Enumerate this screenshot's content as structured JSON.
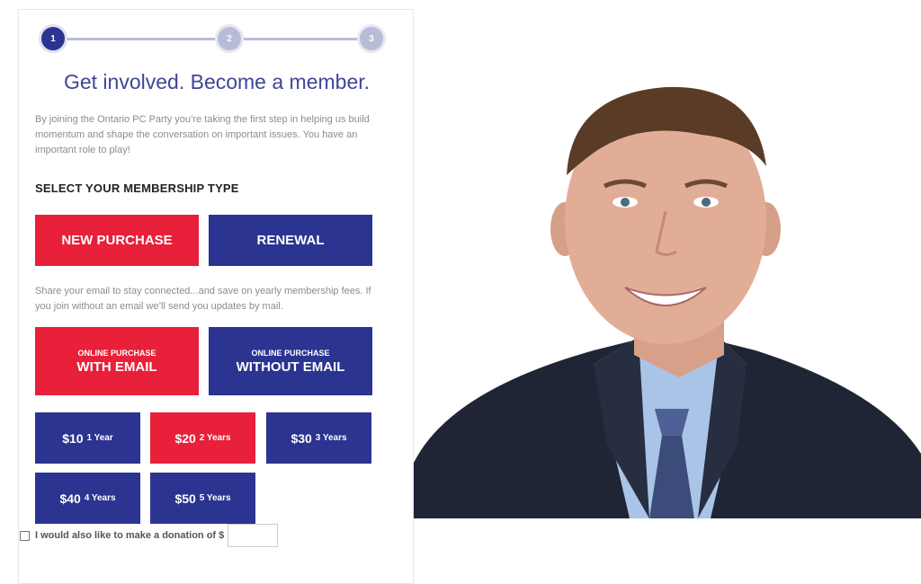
{
  "stepper": {
    "steps": [
      "1",
      "2",
      "3"
    ]
  },
  "title": "Get involved. Become a member.",
  "intro": "By joining the Ontario PC Party you’re taking the first step in helping us build momentum and shape the conversation on important issues. You have an important role to play!",
  "membership": {
    "heading": "SELECT YOUR MEMBERSHIP TYPE",
    "new_purchase": "NEW PURCHASE",
    "renewal": "RENEWAL"
  },
  "email_note": "Share your email to stay connected...and save on yearly membership fees. If you join without an email we’ll send you updates by mail.",
  "purchase": {
    "with_email_top": "ONLINE PURCHASE",
    "with_email_main": "WITH EMAIL",
    "without_email_top": "ONLINE PURCHASE",
    "without_email_main": "WITHOUT EMAIL"
  },
  "options": [
    {
      "price": "$10",
      "term": "1 Year"
    },
    {
      "price": "$20",
      "term": "2 Years"
    },
    {
      "price": "$30",
      "term": "3 Years"
    },
    {
      "price": "$40",
      "term": "4 Years"
    },
    {
      "price": "$50",
      "term": "5 Years"
    }
  ],
  "donation": {
    "label": "I would also like to make a donation of $",
    "value": ""
  },
  "colors": {
    "red": "#e8203a",
    "navy": "#2b3490",
    "step_inactive": "#b9bcd6",
    "title": "#3f4696"
  },
  "photo": {
    "icon": "candidate-portrait"
  }
}
